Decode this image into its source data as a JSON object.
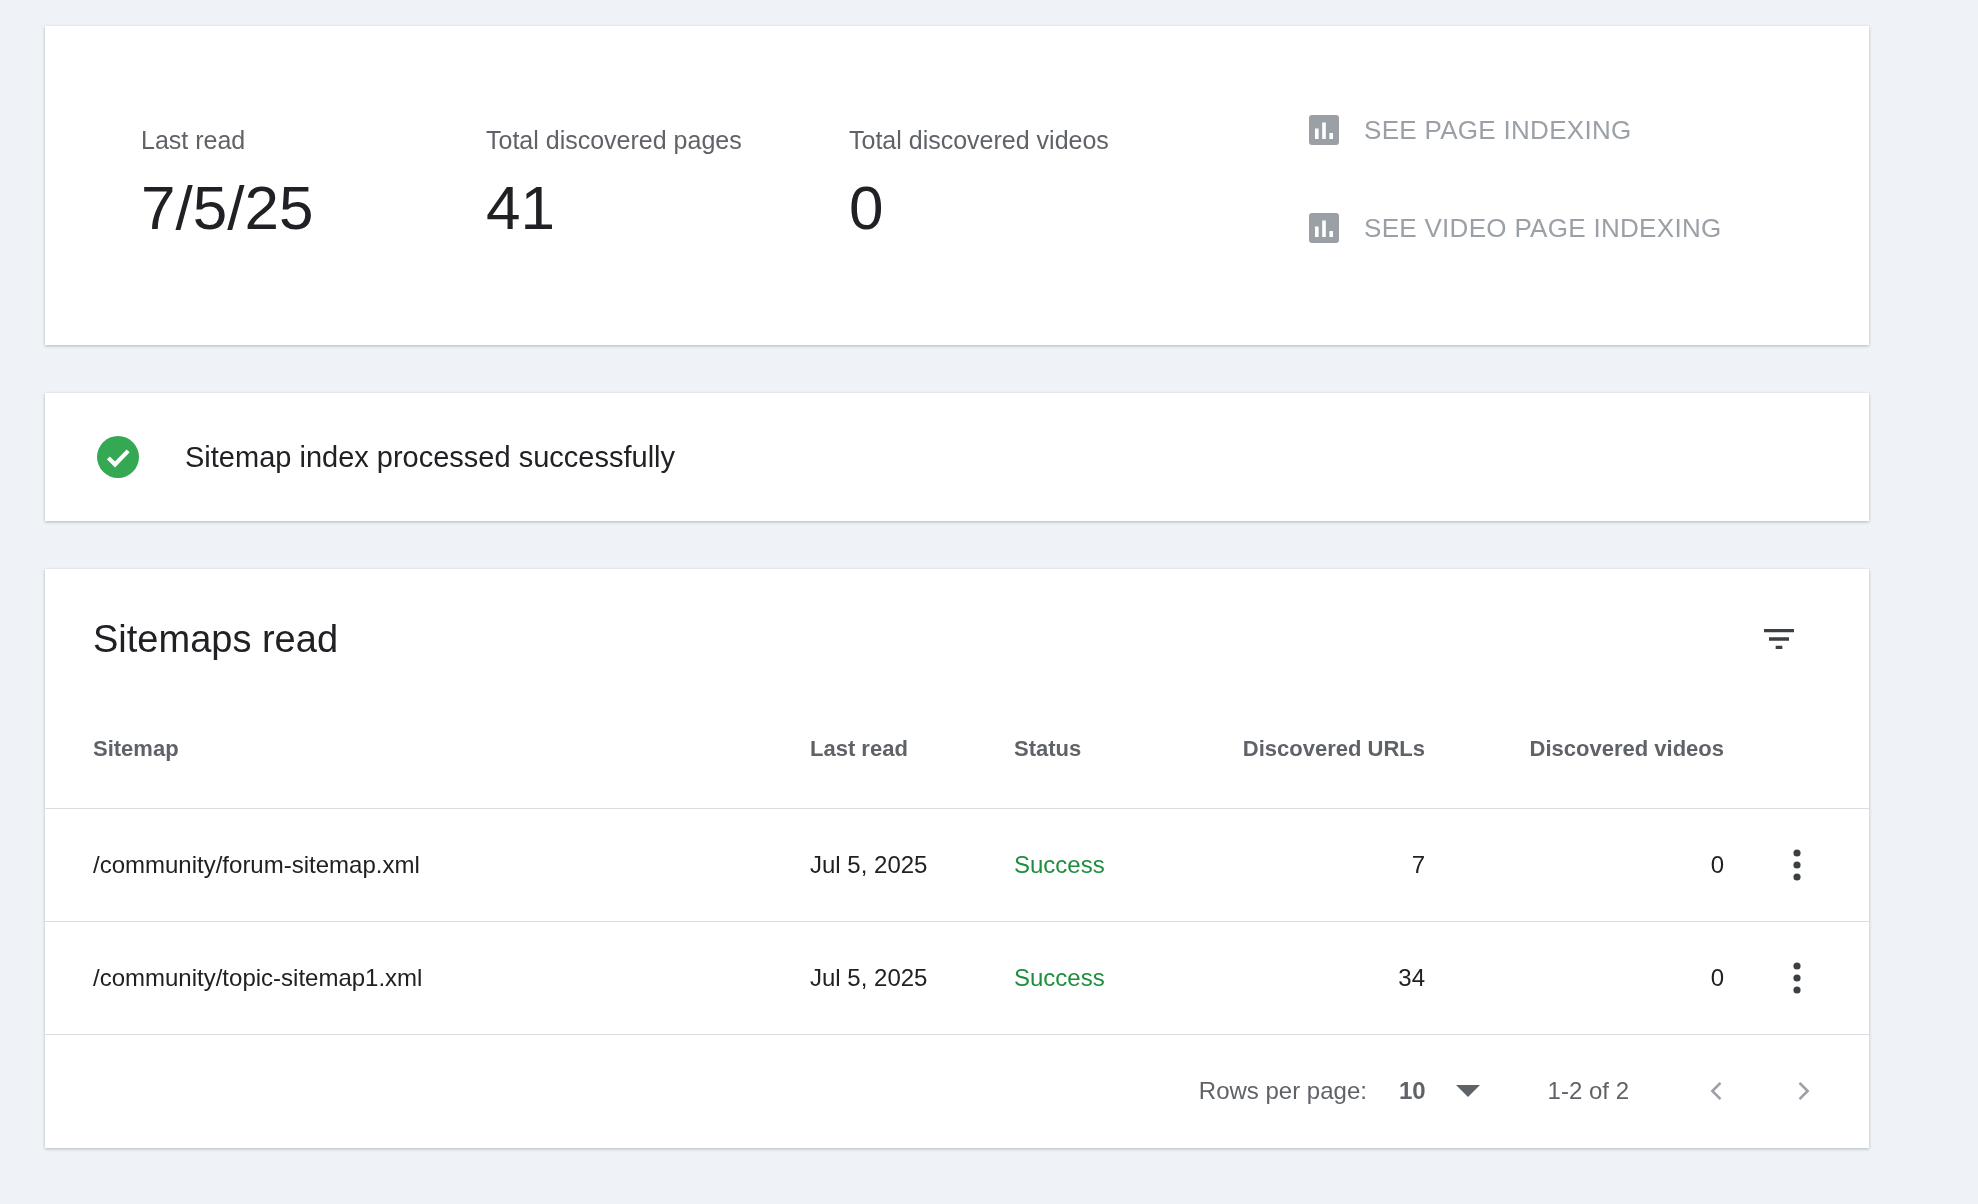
{
  "summary": {
    "stats": [
      {
        "label": "Last read",
        "value": "7/5/25"
      },
      {
        "label": "Total discovered pages",
        "value": "41"
      },
      {
        "label": "Total discovered videos",
        "value": "0"
      }
    ],
    "links": [
      "SEE PAGE INDEXING",
      "SEE VIDEO PAGE INDEXING"
    ]
  },
  "banner": {
    "message": "Sitemap index processed successfully"
  },
  "table": {
    "title": "Sitemaps read",
    "columns": [
      "Sitemap",
      "Last read",
      "Status",
      "Discovered URLs",
      "Discovered videos"
    ],
    "rows": [
      {
        "sitemap": "/community/forum-sitemap.xml",
        "last_read": "Jul 5, 2025",
        "status": "Success",
        "urls": "7",
        "videos": "0"
      },
      {
        "sitemap": "/community/topic-sitemap1.xml",
        "last_read": "Jul 5, 2025",
        "status": "Success",
        "urls": "34",
        "videos": "0"
      }
    ],
    "pagination": {
      "rows_label": "Rows per page:",
      "rows_value": "10",
      "range": "1-2 of 2"
    }
  }
}
